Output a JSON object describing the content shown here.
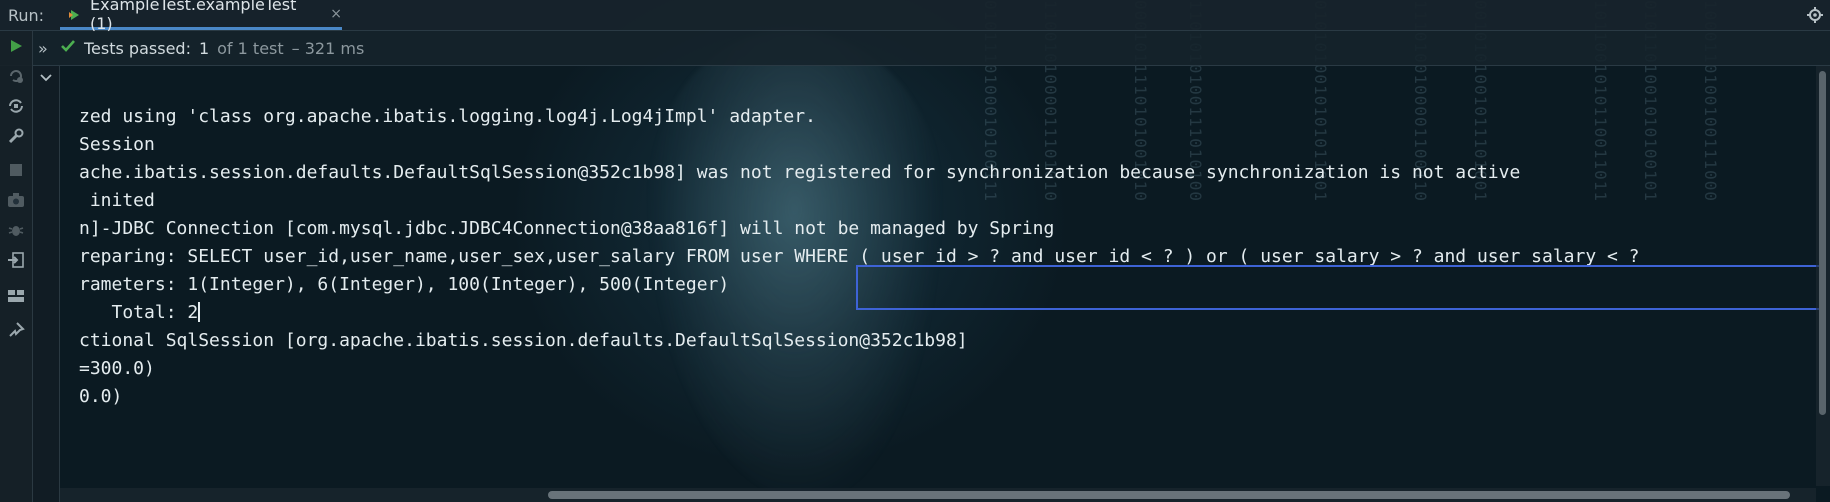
{
  "run_panel": {
    "label": "Run:",
    "tab_title": "ExampleTest.exampleTest (1)",
    "close_glyph": "×"
  },
  "status": {
    "passed_label": "Tests passed:",
    "count_text": "1",
    "of_text": "of 1 test",
    "duration": "– 321 ms"
  },
  "console": {
    "lines": [
      "zed using 'class org.apache.ibatis.logging.log4j.Log4jImpl' adapter.",
      "Session",
      "ache.ibatis.session.defaults.DefaultSqlSession@352c1b98] was not registered for synchronization because synchronization is not active",
      " inited",
      "n]-JDBC Connection [com.mysql.jdbc.JDBC4Connection@38aa816f] will not be managed by Spring",
      "reparing: SELECT user_id,user_name,user_sex,user_salary FROM user WHERE ( user_id > ? and user_id < ? ) or ( user_salary > ? and user_salary < ?",
      "rameters: 1(Integer), 6(Integer), 100(Integer), 500(Integer)",
      "   Total: 2",
      "ctional SqlSession [org.apache.ibatis.session.defaults.DefaultSqlSession@352c1b98]",
      "=300.0)",
      "0.0)"
    ]
  },
  "colors": {
    "accent_tab": "#4a88c7",
    "highlight_box": "#3e63d6",
    "pass_green": "#4caf50",
    "run_green": "#43a047"
  },
  "icons": [
    "run-icon",
    "rerun-failed-icon",
    "toggle-auto-test-icon",
    "settings-wrench-icon",
    "stop-icon",
    "screenshot-icon",
    "debug-icon",
    "import-icon",
    "layout-icon",
    "pin-icon",
    "expand-chevron-icon",
    "collapse-chevron-icon",
    "check-icon",
    "gear-icon"
  ]
}
